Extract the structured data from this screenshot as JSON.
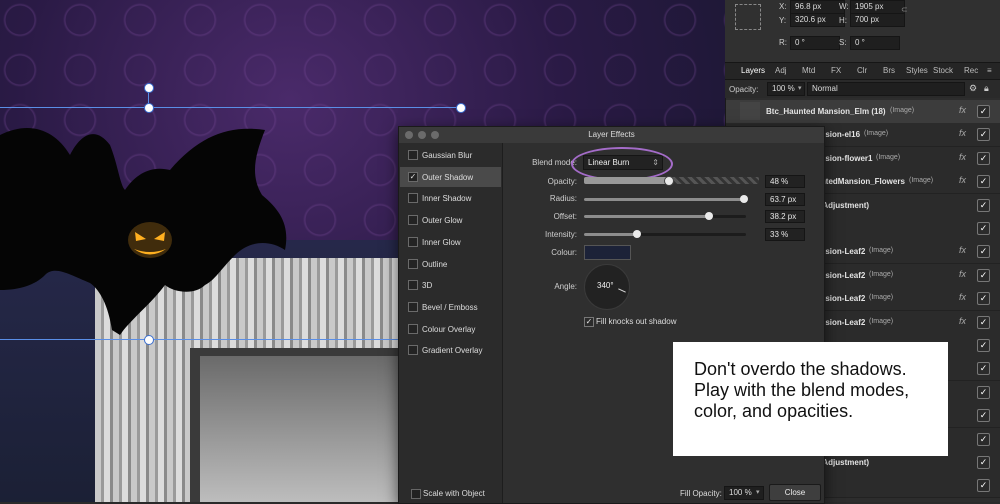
{
  "transform": {
    "x_label": "X:",
    "x_value": "96.8 px",
    "y_label": "Y:",
    "y_value": "320.6 px",
    "w_label": "W:",
    "w_value": "1905 px",
    "h_label": "H:",
    "h_value": "700 px",
    "r_label": "R:",
    "r_value": "0 °",
    "s_label": "S:",
    "s_value": "0 °"
  },
  "panel_tabs": [
    "Layers",
    "Adj",
    "Mtd",
    "FX",
    "Clr",
    "Brs",
    "Styles",
    "Stock",
    "Rec"
  ],
  "layers_panel": {
    "opacity_label": "Opacity:",
    "opacity_value": "100 %",
    "blend_value": "Normal",
    "rows": [
      {
        "name": "Btc_Haunted Mansion_Elm (18)",
        "type": "(Image)",
        "fx": true
      },
      {
        "name": "ansion-el16",
        "type": "(Image)",
        "fx": true
      },
      {
        "name": "ansion-flower1",
        "type": "(Image)",
        "fx": true
      },
      {
        "name": "untedMansion_Flowers",
        "type": "(Image)",
        "fx": true
      },
      {
        "name": "e Adjustment)",
        "type": "",
        "fx": false
      },
      {
        "name": "",
        "type": "",
        "fx": false
      },
      {
        "name": "ansion-Leaf2",
        "type": "(Image)",
        "fx": true
      },
      {
        "name": "ansion-Leaf2",
        "type": "(Image)",
        "fx": true
      },
      {
        "name": "ansion-Leaf2",
        "type": "(Image)",
        "fx": true
      },
      {
        "name": "ansion-Leaf2",
        "type": "(Image)",
        "fx": true
      },
      {
        "name": "",
        "type": "",
        "fx": false
      },
      {
        "name": "",
        "type": "",
        "fx": false
      },
      {
        "name": "",
        "type": "",
        "fx": false
      },
      {
        "name": "",
        "type": "",
        "fx": false
      },
      {
        "name": "",
        "type": "",
        "fx": false
      },
      {
        "name": "e Adjustment)",
        "type": "",
        "fx": false
      },
      {
        "name": "",
        "type": "",
        "fx": false
      }
    ]
  },
  "dialog": {
    "title": "Layer Effects",
    "effects": [
      {
        "label": "Gaussian Blur",
        "checked": false,
        "active": false
      },
      {
        "label": "Outer Shadow",
        "checked": true,
        "active": true
      },
      {
        "label": "Inner Shadow",
        "checked": false,
        "active": false
      },
      {
        "label": "Outer Glow",
        "checked": false,
        "active": false
      },
      {
        "label": "Inner Glow",
        "checked": false,
        "active": false
      },
      {
        "label": "Outline",
        "checked": false,
        "active": false
      },
      {
        "label": "3D",
        "checked": false,
        "active": false
      },
      {
        "label": "Bevel / Emboss",
        "checked": false,
        "active": false
      },
      {
        "label": "Colour Overlay",
        "checked": false,
        "active": false
      },
      {
        "label": "Gradient Overlay",
        "checked": false,
        "active": false
      }
    ],
    "blend_mode_label": "Blend mode:",
    "blend_mode_value": "Linear Burn",
    "opacity_label": "Opacity:",
    "opacity_value": "48 %",
    "opacity_level": 0.48,
    "radius_label": "Radius:",
    "radius_value": "63.7 px",
    "radius_level": 0.99,
    "offset_label": "Offset:",
    "offset_value": "38.2 px",
    "offset_level": 0.77,
    "intensity_label": "Intensity:",
    "intensity_value": "33 %",
    "intensity_level": 0.33,
    "colour_label": "Colour:",
    "colour_swatch": "#1c2238",
    "angle_label": "Angle:",
    "angle_value": "340°",
    "fill_knocks_label": "Fill knocks out shadow",
    "scale_with_object_label": "Scale with Object",
    "fill_opacity_label": "Fill Opacity:",
    "fill_opacity_value": "100 %",
    "close_label": "Close"
  },
  "note": {
    "text": "Don't overdo the shadows. Play with the blend modes, color, and opacities."
  }
}
